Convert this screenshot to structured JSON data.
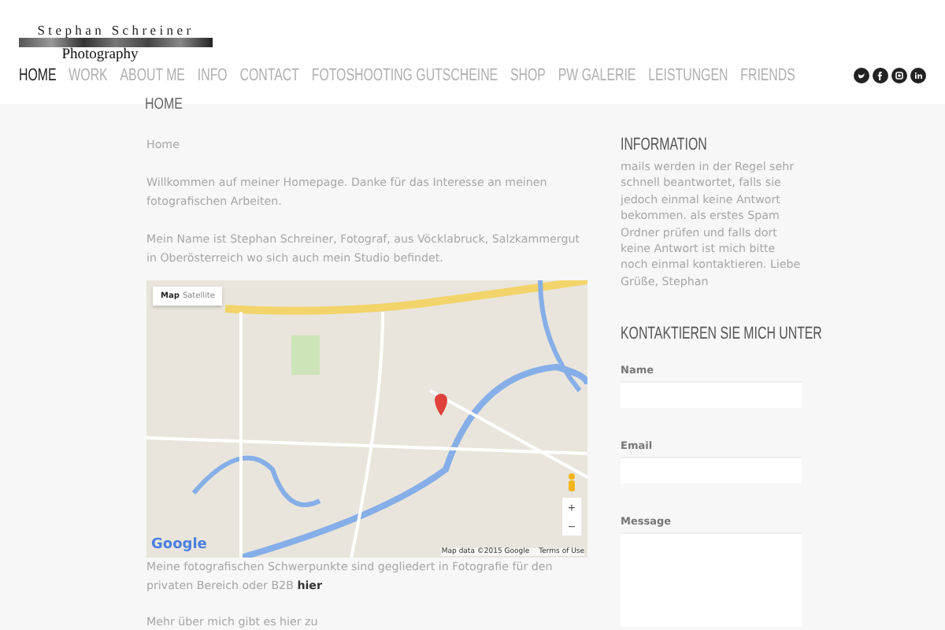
{
  "logo": {
    "name": "Stephan Schreiner",
    "tagline": "Photography"
  },
  "nav": [
    {
      "label": "HOME",
      "selected": true
    },
    {
      "label": "WORK",
      "selected": false
    },
    {
      "label": "ABOUT ME",
      "selected": false
    },
    {
      "label": "INFO",
      "selected": false
    },
    {
      "label": "CONTACT",
      "selected": false
    },
    {
      "label": "FOTOSHOOTING GUTSCHEINE",
      "selected": false
    },
    {
      "label": "SHOP",
      "selected": false
    },
    {
      "label": "PW GALERIE",
      "selected": false
    },
    {
      "label": "LEISTUNGEN",
      "selected": false
    },
    {
      "label": "FRIENDS",
      "selected": false
    }
  ],
  "submenu": [
    "HOME"
  ],
  "social": [
    {
      "kind": "twitter"
    },
    {
      "kind": "facebook"
    },
    {
      "kind": "instagram"
    },
    {
      "kind": "linkedin"
    }
  ],
  "main": {
    "breadcrumb": "Home",
    "paragraphs_before": [
      "Willkommen auf meiner Homepage. Danke für das Interesse an meinen fotografischen Arbeiten.",
      "Mein Name ist Stephan Schreiner, Fotograf, aus Vöcklabruck, Salzkammergut in Oberösterreich wo sich auch mein Studio befindet."
    ],
    "map": {
      "types": [
        {
          "label": "Map",
          "selected": true
        },
        {
          "label": "Satellite",
          "selected": false
        }
      ],
      "zoom_in": "+",
      "zoom_out": "−",
      "logo": "Google",
      "attribution": "Map data ©2015 Google",
      "terms": "Terms of Use"
    },
    "focus_text": "Meine fotografischen Schwerpunkte sind gegliedert in Fotografie für den privaten Bereich oder B2B ",
    "focus_link": "hier",
    "more": "Mehr über mich gibt es hier zu"
  },
  "sidebar": {
    "info_title": "INFORMATION",
    "info_text": "mails werden in der Regel sehr schnell beantwortet, falls sie jedoch einmal keine Antwort bekommen. als erstes Spam Ordner prüfen und falls dort keine Antwort ist mich bitte noch einmal kontaktieren. Liebe Grüße, Stephan",
    "contact_title": "KONTAKTIEREN SIE MICH UNTER",
    "fields": [
      {
        "label": "Name",
        "kind": "text"
      },
      {
        "label": "Email",
        "kind": "text"
      },
      {
        "label": "Message",
        "kind": "textarea"
      }
    ]
  }
}
